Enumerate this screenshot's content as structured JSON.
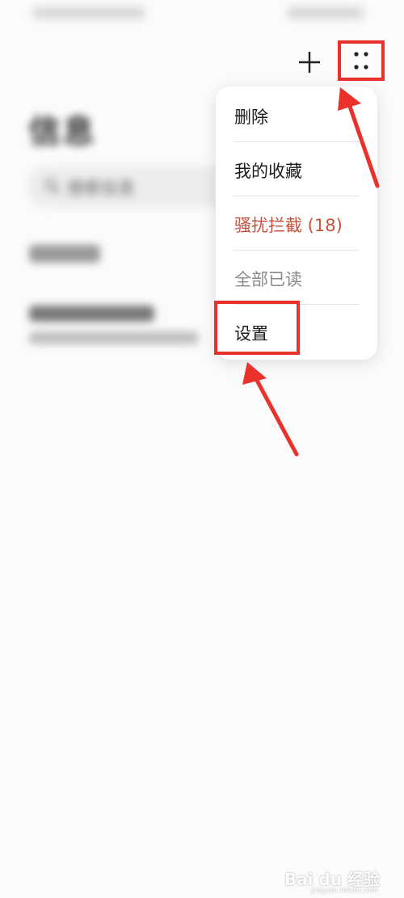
{
  "page": {
    "title": "信息",
    "search_placeholder": "搜索信息"
  },
  "header": {
    "add_icon": "plus-icon",
    "more_icon": "more-dots-icon"
  },
  "menu": {
    "items": [
      {
        "label": "删除"
      },
      {
        "label": "我的收藏"
      },
      {
        "label": "骚扰拦截 (18)"
      },
      {
        "label": "全部已读"
      },
      {
        "label": "设置"
      }
    ]
  },
  "watermark": {
    "text": "Bai du 经验",
    "sub": "jingyan.baidu.com"
  },
  "colors": {
    "highlight": "#e8322b",
    "warn": "#c5533c",
    "disabled": "#8a8a8a"
  }
}
